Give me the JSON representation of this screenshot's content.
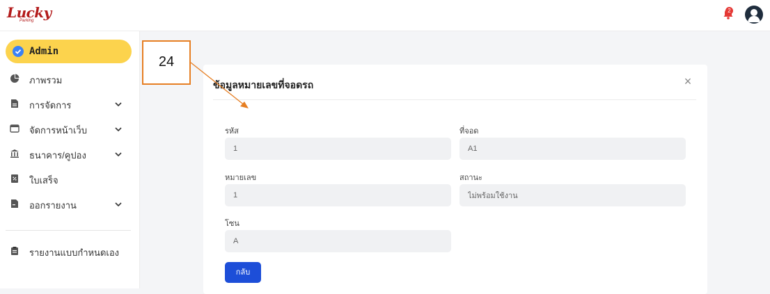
{
  "header": {
    "logo": "Lucky",
    "logo_sub": "Parking",
    "notification_count": "2"
  },
  "sidebar": {
    "active": "Admin",
    "items": [
      {
        "label": "ภาพรวม",
        "icon": "pie-chart-icon",
        "expandable": false
      },
      {
        "label": "การจัดการ",
        "icon": "document-icon",
        "expandable": true
      },
      {
        "label": "จัดการหน้าเว็บ",
        "icon": "browser-icon",
        "expandable": true
      },
      {
        "label": "ธนาคาร/คูปอง",
        "icon": "bank-icon",
        "expandable": true
      },
      {
        "label": "ใบเสร็จ",
        "icon": "receipt-icon",
        "expandable": false
      },
      {
        "label": "ออกรายงาน",
        "icon": "report-icon",
        "expandable": true
      }
    ],
    "bottom_items": [
      {
        "label": "รายงานแบบกำหนดเอง",
        "icon": "clipboard-icon"
      }
    ]
  },
  "card": {
    "title": "ข้อมูลหมายเลขที่จอดรถ",
    "fields": {
      "code": {
        "label": "รหัส",
        "value": "1"
      },
      "spot": {
        "label": "ที่จอด",
        "value": "A1"
      },
      "number": {
        "label": "หมายเลข",
        "value": "1"
      },
      "status": {
        "label": "สถานะ",
        "value": "ไม่พร้อมใช้งาน"
      },
      "zone": {
        "label": "โซน",
        "value": "A"
      }
    },
    "back_label": "กลับ"
  },
  "annotation": {
    "number": "24"
  },
  "colors": {
    "accent": "#fcd34d",
    "primary": "#1d4ed8",
    "annotation": "#e67e22",
    "logo": "#b31b1b"
  }
}
